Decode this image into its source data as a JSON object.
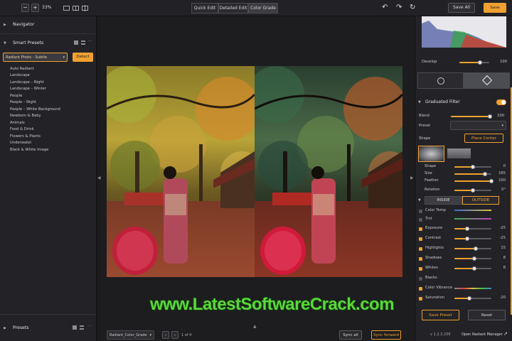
{
  "topbar": {
    "zoom_minus": "−",
    "zoom_plus": "+",
    "zoom_value": "33%",
    "tabs": [
      "Quick Edit",
      "Detailed Edit",
      "Color Grade"
    ],
    "save_all": "Save All",
    "save": "Save"
  },
  "left": {
    "navigator": "Navigator",
    "smart_presets": "Smart Presets",
    "preset_select": "Radiant Photo - Subtle",
    "detect_button": "Detect",
    "preset_items": [
      "Auto Radiant",
      "Landscape",
      "Landscape – Night",
      "Landscape – Winter",
      "People",
      "People – Night",
      "People – White Background",
      "Newborn & Baby",
      "Animals",
      "Food & Drink",
      "Flowers & Plants",
      "Underwater",
      "Black & White Image"
    ],
    "presets": "Presets"
  },
  "bottom": {
    "file_name": "Radiant_Color_Grade",
    "page_count": "1 of 4",
    "sync_all": "Sync all",
    "sync_forward": "Sync forward"
  },
  "watermark": "www.LatestSoftwareCrack.com",
  "right": {
    "develop": {
      "label": "Develop",
      "value": "100",
      "level": 0.7
    },
    "graduated_filter": "Graduated Filter",
    "blend": {
      "label": "Blend",
      "value": "100",
      "level": 1.0
    },
    "preset_label": "Preset",
    "shape_label": "Shape",
    "place_center": "Place Center",
    "shape_sliders": [
      {
        "label": "Shape",
        "value": "0",
        "level": 0.5
      },
      {
        "label": "Size",
        "value": "165",
        "level": 0.82
      },
      {
        "label": "Feather",
        "value": "100",
        "level": 1.0
      },
      {
        "label": "Rotation",
        "value": "0°",
        "level": 0.5
      }
    ],
    "inside": "INSIDE",
    "outside": "OUTSIDE",
    "adjustments": [
      {
        "label": "Color Temp",
        "value": "",
        "level": 0.5,
        "checked": false
      },
      {
        "label": "Tint",
        "value": "",
        "level": 0.5,
        "checked": false
      },
      {
        "label": "Exposure",
        "value": "-25",
        "level": 0.35,
        "checked": true
      },
      {
        "label": "Contrast",
        "value": "-25",
        "level": 0.35,
        "checked": true
      },
      {
        "label": "Highlights",
        "value": "15",
        "level": 0.58,
        "checked": true
      },
      {
        "label": "Shadows",
        "value": "8",
        "level": 0.53,
        "checked": true
      },
      {
        "label": "Whites",
        "value": "8",
        "level": 0.53,
        "checked": true
      },
      {
        "label": "Blacks",
        "value": "",
        "level": 0.5,
        "checked": false
      },
      {
        "label": "Color Vibrance",
        "value": "",
        "level": 0.5,
        "checked": true
      },
      {
        "label": "Saturation",
        "value": "-20",
        "level": 0.4,
        "checked": true
      }
    ],
    "save_preset": "Save Preset",
    "reset": "Reset",
    "version": "v 1.2.3.239",
    "open_manager": "Open Radiant Manager"
  }
}
